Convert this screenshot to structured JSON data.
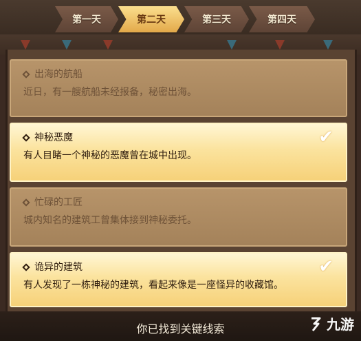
{
  "tabs": [
    {
      "label": "第一天",
      "active": false
    },
    {
      "label": "第二天",
      "active": true
    },
    {
      "label": "第三天",
      "active": false
    },
    {
      "label": "第四天",
      "active": false
    }
  ],
  "clues": [
    {
      "title": "出海的航船",
      "desc": "近日，有一艘航船未经报备，秘密出海。",
      "found": false
    },
    {
      "title": "神秘恶魔",
      "desc": "有人目睹一个神秘的恶魔曾在城中出现。",
      "found": true
    },
    {
      "title": "忙碌的工匠",
      "desc": "城内知名的建筑工曾集体接到神秘委托。",
      "found": false
    },
    {
      "title": "诡异的建筑",
      "desc": "有人发现了一栋神秘的建筑，看起来像是一座怪异的收藏馆。",
      "found": true
    }
  ],
  "footer": {
    "status_text": "你已找到关键线索"
  },
  "watermark": {
    "text": "九游"
  },
  "colors": {
    "active_tab": "#f0c060",
    "found_card": "#fbe39e",
    "dim_card": "#b08e64"
  }
}
